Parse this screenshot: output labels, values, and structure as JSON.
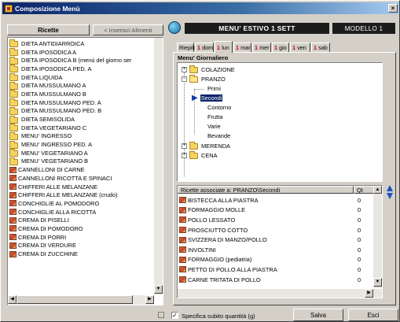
{
  "window": {
    "title": "Composizione Menù",
    "close_glyph": "×"
  },
  "left": {
    "ricette_label": "Ricette",
    "inserisci_label": "< Inserisci Alimenti",
    "items": [
      {
        "t": "folder",
        "label": "DIETA ANTIDIARROICA"
      },
      {
        "t": "folder",
        "label": "DIETA IPOSODICA A"
      },
      {
        "t": "folder",
        "label": "DIETA IPOSODICA B (menù del giorno ser"
      },
      {
        "t": "folder",
        "label": "DIETA IPOSODICA PED. A"
      },
      {
        "t": "folder",
        "label": "DIETA LIQUIDA"
      },
      {
        "t": "folder",
        "label": "DIETA MUSSULMANO A"
      },
      {
        "t": "folder",
        "label": "DIETA MUSSULMANO B"
      },
      {
        "t": "folder",
        "label": "DIETA MUSSULMANO PED. A"
      },
      {
        "t": "folder",
        "label": "DIETA MUSSULMANO PED. B"
      },
      {
        "t": "folder",
        "label": "DIETA SEMISOLIDA"
      },
      {
        "t": "folder",
        "label": "DIETA VEGETARIANO C"
      },
      {
        "t": "folder",
        "label": "MENU' INGRESSO"
      },
      {
        "t": "folder",
        "label": "MENU' INGRESSO PED. A"
      },
      {
        "t": "folder",
        "label": "MENU' VEGETARIANO A"
      },
      {
        "t": "folder",
        "label": "MENU' VEGETARIANO B"
      },
      {
        "t": "dish",
        "label": "CANNELLONI DI CARNE"
      },
      {
        "t": "dish",
        "label": "CANNELLONI RICOTTA E SPINACI"
      },
      {
        "t": "dish",
        "label": "CHIFFERI ALLE MELANZANE"
      },
      {
        "t": "dish",
        "label": "CHIFFERI ALLE MELANZANE (crudo)"
      },
      {
        "t": "dish",
        "label": "CONCHIGLIE AL POMODORO"
      },
      {
        "t": "dish",
        "label": "CONCHIGLIE ALLA RICOTTA"
      },
      {
        "t": "dish",
        "label": "CREMA DI PISELLI"
      },
      {
        "t": "dish",
        "label": "CREMA DI POMODORO"
      },
      {
        "t": "dish",
        "label": "CREMA DI PORRI"
      },
      {
        "t": "dish",
        "label": "CREMA DI VERDURE"
      },
      {
        "t": "dish",
        "label": "CREMA DI ZUCCHINE"
      }
    ]
  },
  "header": {
    "menu_name": "MENU' ESTIVO 1 SETT",
    "model": "MODELLO 1"
  },
  "tabs": [
    {
      "label": "Riepilogo",
      "prefix": ""
    },
    {
      "label": "dom",
      "prefix": "1"
    },
    {
      "label": "lun",
      "prefix": "1"
    },
    {
      "label": "mar",
      "prefix": "1"
    },
    {
      "label": "mer",
      "prefix": "1"
    },
    {
      "label": "gio",
      "prefix": "1"
    },
    {
      "label": "ven",
      "prefix": "1"
    },
    {
      "label": "sab",
      "prefix": "1"
    }
  ],
  "tree": {
    "title": "Menu' Giornaliero",
    "colazione": "COLAZIONE",
    "pranzo": "PRANZO",
    "primi": "Primi",
    "secondi": "Secondi",
    "contorno": "Contorno",
    "frutta": "Frutta",
    "varie": "Varie",
    "bevande": "Bevande",
    "merenda": "MERENDA",
    "cena": "CENA",
    "expand": "+",
    "collapse": "−"
  },
  "recipes": {
    "header": "Ricette associate a: PRANZO\\Secondi",
    "qty_header": "Qt",
    "rows": [
      {
        "label": "BISTECCA ALLA PIASTRA",
        "qty": "0"
      },
      {
        "label": "FORMAGGIO MOLLE",
        "qty": "0"
      },
      {
        "label": "POLLO LESSATO",
        "qty": "0"
      },
      {
        "label": "PROSCIUTTO COTTO",
        "qty": "0"
      },
      {
        "label": "SVIZZERA DI MANZO/POLLO",
        "qty": "0"
      },
      {
        "label": "INVOLTINI",
        "qty": "0"
      },
      {
        "label": "FORMAGGIO (pediatria)",
        "qty": "0"
      },
      {
        "label": "PETTO DI POLLO ALLA PIASTRA",
        "qty": "0"
      },
      {
        "label": "CARNE TRITATA DI POLLO",
        "qty": "0"
      }
    ]
  },
  "footer": {
    "check_label": "Specifica subito quantità (g)",
    "check_mark": "✓",
    "salva": "Salva",
    "esci": "Esci"
  },
  "colors": {
    "title_start": "#0a246a",
    "accent_tab": "#d00000",
    "dark_header": "#1c1c1c",
    "selected": "#0a246a"
  }
}
